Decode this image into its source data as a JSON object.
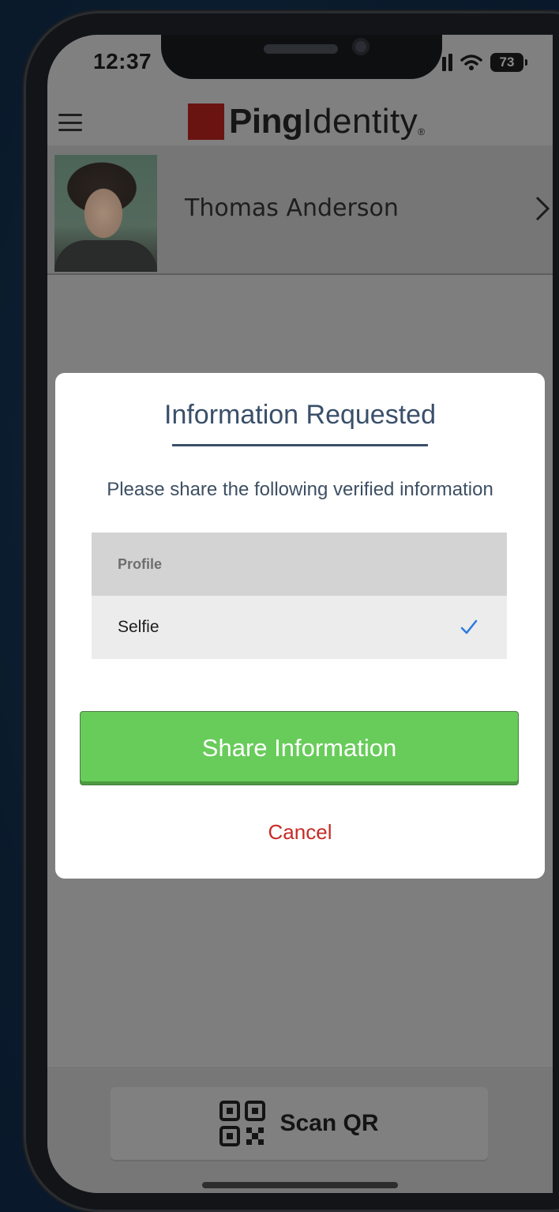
{
  "status_bar": {
    "time": "12:37",
    "battery": "73",
    "icons": [
      "signal-icon",
      "wifi-icon",
      "battery-icon"
    ]
  },
  "header": {
    "logo_bold": "Ping",
    "logo_light": "Identity",
    "logo_mark": "®",
    "logo_color": "#6a1412",
    "menu_icon": "hamburger-menu-icon"
  },
  "profile": {
    "name": "Thomas Anderson",
    "chevron_icon": "chevron-right-icon"
  },
  "modal": {
    "title": "Information Requested",
    "subtitle": "Please share the following verified information",
    "list_header": "Profile",
    "items": [
      {
        "label": "Selfie",
        "checked": true
      }
    ],
    "share_label": "Share Information",
    "cancel_label": "Cancel",
    "accent_color": "#3a4f6a",
    "share_color": "#68cc5a",
    "cancel_color": "#c62b25",
    "check_color": "#2f7be0"
  },
  "bottom_bar": {
    "scan_label": "Scan QR",
    "scan_icon": "qr-code-icon"
  }
}
